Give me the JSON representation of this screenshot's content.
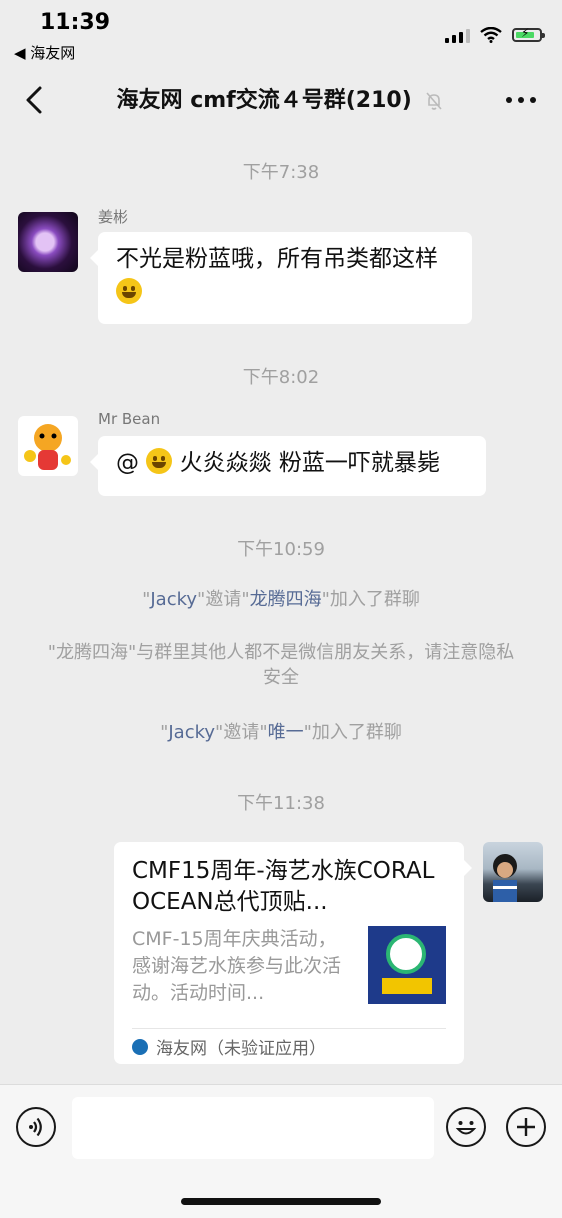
{
  "status_bar": {
    "time": "11:39",
    "back_app": "◀ 海友网"
  },
  "nav": {
    "title": "海友网 cmf交流４号群(210)"
  },
  "messages": {
    "ts1": "下午7:38",
    "msg1": {
      "sender": "姜彬",
      "text": "不光是粉蓝哦，所有吊类都这样"
    },
    "ts2": "下午8:02",
    "msg2": {
      "sender": "Mr Bean",
      "prefix": "@",
      "text": "火炎焱燚 粉蓝一吓就暴毙"
    },
    "ts3": "下午10:59",
    "sys1": {
      "q1": "\"",
      "name1": "Jacky",
      "mid": "\"邀请\"",
      "name2": "龙腾四海",
      "end": "\"加入了群聊"
    },
    "sys2": "\"龙腾四海\"与群里其他人都不是微信朋友关系，请注意隐私安全",
    "sys3": {
      "q1": "\"",
      "name1": "Jacky",
      "mid": "\"邀请\"",
      "name2": "唯一",
      "end": "\"加入了群聊"
    },
    "ts4": "下午11:38",
    "card": {
      "title": "CMF15周年-海艺水族CORAL OCEAN总代顶贴...",
      "desc": "CMF-15周年庆典活动，感谢海艺水族参与此次活动。活动时间...",
      "source": "海友网（未验证应用）"
    }
  },
  "colors": {
    "background": "#ededed",
    "bubble": "#ffffff",
    "link": "#576b95",
    "system_text": "#a0a0a0"
  }
}
